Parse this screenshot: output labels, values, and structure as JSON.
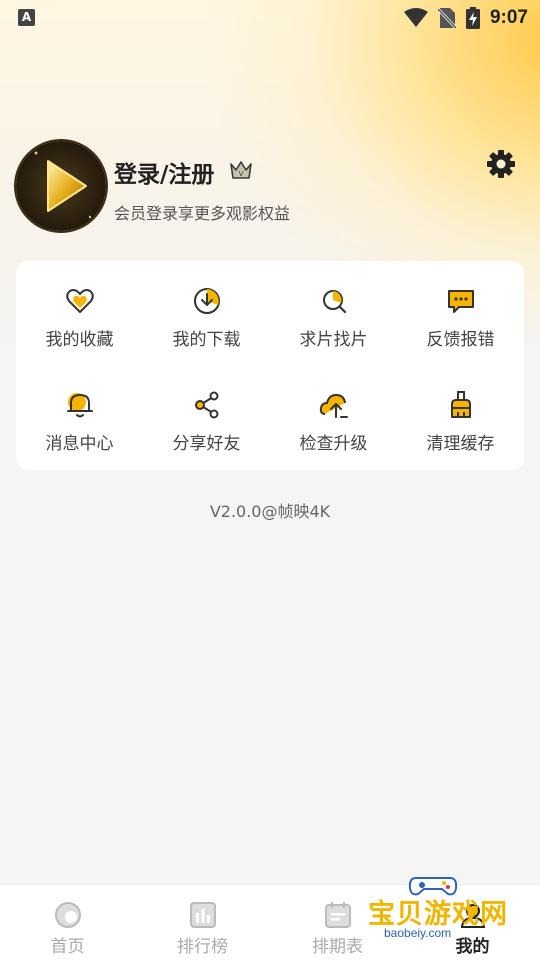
{
  "status_bar": {
    "time": "9:07",
    "indicator": "A"
  },
  "profile": {
    "title": "登录/注册",
    "subtitle": "会员登录享更多观影权益"
  },
  "menu": {
    "items": [
      {
        "label": "我的收藏",
        "icon": "heart-icon"
      },
      {
        "label": "我的下载",
        "icon": "download-icon"
      },
      {
        "label": "求片找片",
        "icon": "search-icon"
      },
      {
        "label": "反馈报错",
        "icon": "feedback-icon"
      },
      {
        "label": "消息中心",
        "icon": "bell-icon"
      },
      {
        "label": "分享好友",
        "icon": "share-icon"
      },
      {
        "label": "检查升级",
        "icon": "upgrade-icon"
      },
      {
        "label": "清理缓存",
        "icon": "broom-icon"
      }
    ]
  },
  "version": "V2.0.0@帧映4K",
  "bottom_nav": {
    "items": [
      {
        "label": "首页",
        "icon": "home-icon"
      },
      {
        "label": "排行榜",
        "icon": "chart-icon"
      },
      {
        "label": "排期表",
        "icon": "calendar-icon"
      },
      {
        "label": "我的",
        "icon": "user-icon"
      }
    ]
  },
  "watermark": {
    "text": "宝贝游戏网",
    "url": "baobeiy.com"
  },
  "colors": {
    "accent": "#f7b500",
    "background": "#f5f5f5",
    "card": "#ffffff"
  }
}
